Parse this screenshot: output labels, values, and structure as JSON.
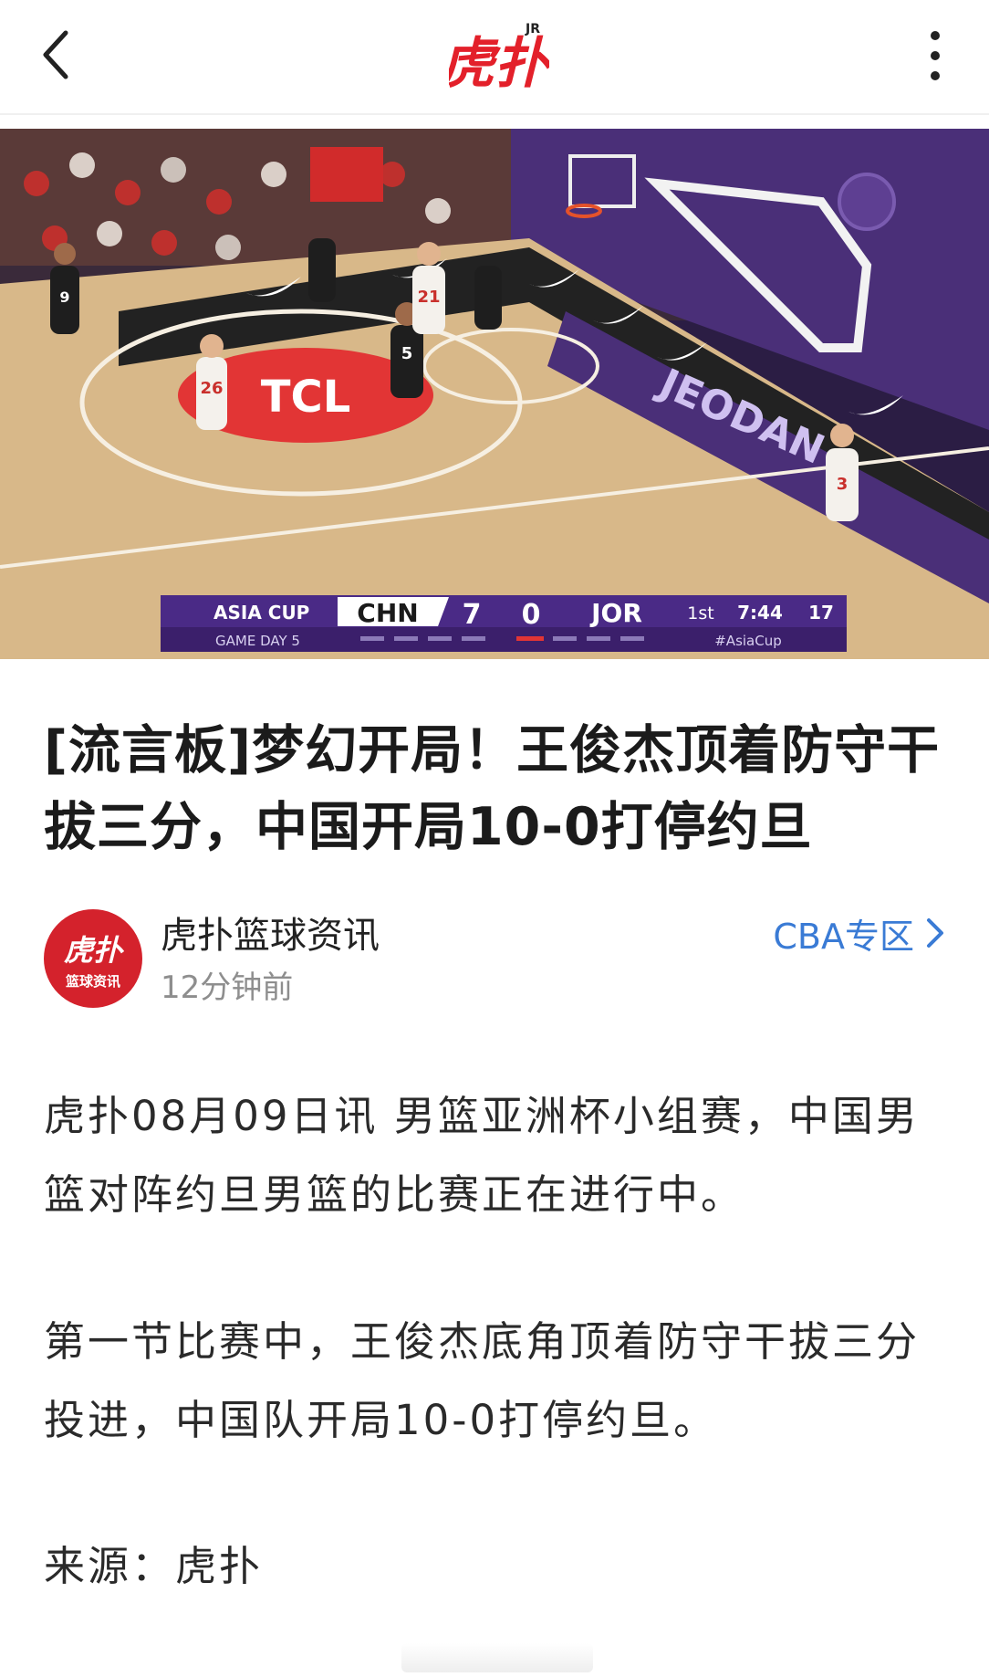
{
  "header": {
    "logo_text": "虎扑",
    "logo_badge": "JR"
  },
  "hero": {
    "scoreboard": {
      "event": "ASIA CUP",
      "day": "GAME DAY 5",
      "home_team": "CHN",
      "home_score": "7",
      "away_score": "0",
      "away_team": "JOR",
      "period": "1st",
      "clock": "7:44",
      "shot_clock": "17",
      "hashtag": "#AsiaCup"
    },
    "court_logo": "TCL",
    "sideline_text": "JEODAN",
    "jersey_numbers": [
      "26",
      "5",
      "3",
      "21",
      "9"
    ]
  },
  "article": {
    "title": "[流言板]梦幻开局！王俊杰顶着防守干拔三分，中国开局10-0打停约旦",
    "author": {
      "name": "虎扑篮球资讯",
      "time": "12分钟前",
      "avatar_line1": "虎扑",
      "avatar_line2": "篮球资讯"
    },
    "zone_link": "CBA专区",
    "paragraphs": [
      "虎扑08月09日讯 男篮亚洲杯小组赛，中国男篮对阵约旦男篮的比赛正在进行中。",
      "第一节比赛中，王俊杰底角顶着防守干拔三分投进，中国队开局10-0打停约旦。",
      "来源：虎扑"
    ]
  },
  "colors": {
    "brand_red": "#d4222c",
    "link_blue": "#3a7bd5",
    "court_wood": "#d8b889",
    "court_purple": "#4a2f78"
  }
}
